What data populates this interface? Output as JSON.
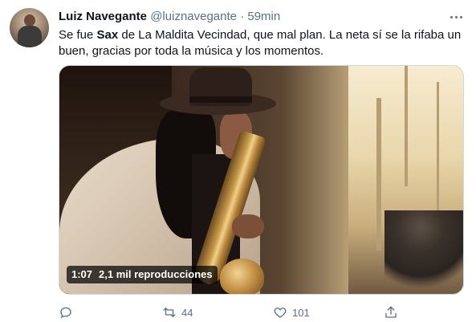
{
  "tweet": {
    "author_name": "Luiz Navegante",
    "handle": "@luiznavegante",
    "separator": "·",
    "time": "59min",
    "text_before": "Se fue ",
    "text_bold": "Sax",
    "text_after": " de La Maldita Vecindad, que mal plan. La neta sí se la rifaba un buen, gracias por toda la música y los momentos."
  },
  "video": {
    "duration": "1:07",
    "views": "2,1 mil reproducciones"
  },
  "actions": {
    "reply_icon": "reply-icon",
    "retweet_icon": "retweet-icon",
    "retweet_count": "44",
    "like_icon": "heart-icon",
    "like_count": "101",
    "share_icon": "share-icon"
  },
  "colors": {
    "text_primary": "#0f1419",
    "text_secondary": "#5b7083"
  }
}
